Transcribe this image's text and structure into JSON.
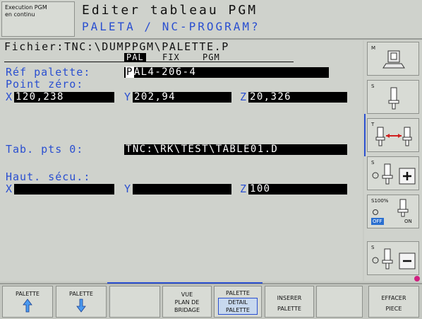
{
  "header": {
    "mode_line1": "Execution PGM",
    "mode_line2": "en continu",
    "title_line1": "Editer tableau PGM",
    "title_line2": "PALETA / NC-PROGRAM?"
  },
  "main": {
    "file_label": "Fichier:TNC:\\DUMPPGM\\PALETTE.P",
    "tabs": {
      "pal": "PAL",
      "fix": "FIX",
      "pgm": "PGM"
    },
    "ref_palette": {
      "label": "Réf palette:",
      "value_cursor": "P",
      "value_rest": "AL4-206-4"
    },
    "point_zero": {
      "label": "Point zéro:",
      "x_label": "X",
      "x_value": "120,238",
      "y_label": "Y",
      "y_value": "202,94",
      "z_label": "Z",
      "z_value": "20,326"
    },
    "tab_pts": {
      "label": "Tab. pts 0:",
      "value": "TNC:\\RK\\TEST\\TABLE01.D"
    },
    "haut_secu": {
      "label": "Haut. sécu.:",
      "x_label": "X",
      "x_value": "",
      "y_label": "Y",
      "y_value": "",
      "z_label": "Z",
      "z_value": "100"
    }
  },
  "sidebar": {
    "m_key": "M",
    "s_key1": "S",
    "t_key": "T",
    "s_key2": "S",
    "override_label": "S100%",
    "off_label": "OFF",
    "on_label": "ON",
    "s_key3": "S"
  },
  "softkeys": {
    "palette_up": "PALETTE",
    "palette_down": "PALETTE",
    "vue_line1": "VUE",
    "vue_line2": "PLAN DE",
    "vue_line3": "BRIDAGE",
    "palette_detail_line1": "PALETTE",
    "palette_detail_line2": "DETAIL",
    "palette_detail_line3": "PALETTE",
    "inserer_line1": "INSERER",
    "inserer_line2": "PALETTE",
    "effacer_line1": "EFFACER",
    "effacer_line2": "PIECE"
  },
  "colors": {
    "accent": "#2a4fd0",
    "field_bg": "#000000",
    "panel_bg": "#cfd2cc",
    "highlight": "#c7d8ee"
  }
}
